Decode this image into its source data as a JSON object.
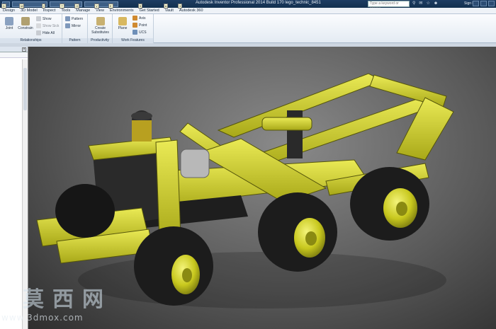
{
  "titlebar": {
    "title": "Autodesk Inventor Professional 2014 Build 170   lego_technic_8451",
    "search_placeholder": "Type a keyword or phrase",
    "sign_in": "Sign In"
  },
  "tabs": [
    {
      "label": "Design",
      "key": "D"
    },
    {
      "label": "3D Model",
      "key": "M"
    },
    {
      "label": "Inspect",
      "key": "I"
    },
    {
      "label": "Tools",
      "key": "T"
    },
    {
      "label": "Manage",
      "key": "G"
    },
    {
      "label": "View",
      "key": "V"
    },
    {
      "label": "Environments",
      "key": "E"
    },
    {
      "label": "Get Started",
      "key": "S"
    },
    {
      "label": "Vault",
      "key": "A"
    },
    {
      "label": "Autodesk 360",
      "key": "3"
    }
  ],
  "ribbon": {
    "relationships": {
      "title": "Relationships",
      "joint": "Joint",
      "constrain": "Constrain",
      "show": "Show",
      "show_sick": "Show Sick",
      "hide_all": "Hide All"
    },
    "pattern": {
      "title": "Pattern",
      "pattern": "Pattern",
      "mirror": "Mirror"
    },
    "productivity": {
      "title": "Productivity",
      "create": "Create",
      "substitutes": "Substitutes"
    },
    "work_features": {
      "title": "Work Features",
      "plane": "Plane",
      "axis": "Axis",
      "point": "Point",
      "ucs": "UCS"
    }
  },
  "watermark": {
    "cn": "莫西网",
    "url": "www.3dmox.com"
  },
  "colors": {
    "lego_yellow": "#d8d82a",
    "tire_black": "#1c1c1c",
    "titlebar": "#1e3d63"
  }
}
